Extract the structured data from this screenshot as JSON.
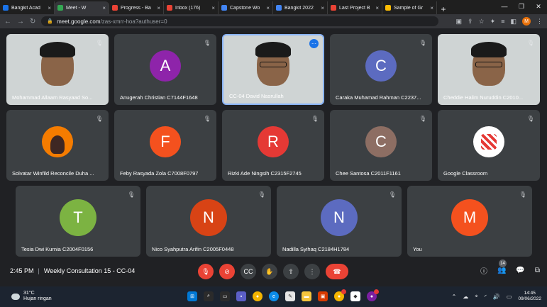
{
  "browser": {
    "tabs": [
      {
        "label": "Bangkit Acad",
        "color": "#1a73e8",
        "active": false
      },
      {
        "label": "Meet - W",
        "color": "#34a853",
        "active": true
      },
      {
        "label": "Progress - Ba",
        "color": "#ea4335",
        "active": false
      },
      {
        "label": "Inbox (176)",
        "color": "#ea4335",
        "active": false
      },
      {
        "label": "Capstone Wo",
        "color": "#4285f4",
        "active": false
      },
      {
        "label": "Bangkit 2022",
        "color": "#4285f4",
        "active": false
      },
      {
        "label": "Last Project B",
        "color": "#ea4335",
        "active": false
      },
      {
        "label": "Sample of Gr",
        "color": "#fbbc04",
        "active": false
      }
    ],
    "url_host": "meet.google.com",
    "url_path": "/zas-xmrr-hoa?authuser=0",
    "profile_initial": "M"
  },
  "tiles": [
    {
      "name": "Mohammad Allaam Rasyaad So...",
      "initial": "",
      "color": "",
      "video": true
    },
    {
      "name": "Anugerah Christian C7144F1648",
      "initial": "A",
      "color": "#8e24aa",
      "video": false
    },
    {
      "name": "CC-04 David Nasrullah",
      "initial": "",
      "color": "",
      "video": true
    },
    {
      "name": "Caraka Muhamad Rahman C2237...",
      "initial": "C",
      "color": "#5c6bc0",
      "video": false
    },
    {
      "name": "Cheddie Halim Nuruddin C2010...",
      "initial": "",
      "color": "",
      "video": true
    },
    {
      "name": "Solvatar Winfild Reconcile Duha ...",
      "initial": "",
      "color": "",
      "video": false
    },
    {
      "name": "Feby Rasyada Zola C7008F0797",
      "initial": "F",
      "color": "#f4511e",
      "video": false
    },
    {
      "name": "Rizki Ade Ningsih C2315F2745",
      "initial": "R",
      "color": "#e53935",
      "video": false
    },
    {
      "name": "Chee Santosa C2011F1161",
      "initial": "C",
      "color": "#8d6e63",
      "video": false
    },
    {
      "name": "Google Classroom",
      "initial": "",
      "color": "",
      "video": false
    },
    {
      "name": "Tesia Dwi Kurnia C2004F0156",
      "initial": "T",
      "color": "#7cb342",
      "video": false
    },
    {
      "name": "Nico Syahputra Arifin C2005F0448",
      "initial": "N",
      "color": "#d84315",
      "video": false
    },
    {
      "name": "Nadilla Syihaq C2184H1784",
      "initial": "N",
      "color": "#5c6bc0",
      "video": false
    },
    {
      "name": "You",
      "initial": "M",
      "color": "#f4511e",
      "video": false
    }
  ],
  "meeting": {
    "time": "2:45 PM",
    "title": "Weekly Consultation 15 - CC-04",
    "participant_count": "14"
  },
  "taskbar": {
    "temperature": "31°C",
    "weather": "Hujan ringan",
    "time": "14:45",
    "date": "09/06/2022"
  }
}
